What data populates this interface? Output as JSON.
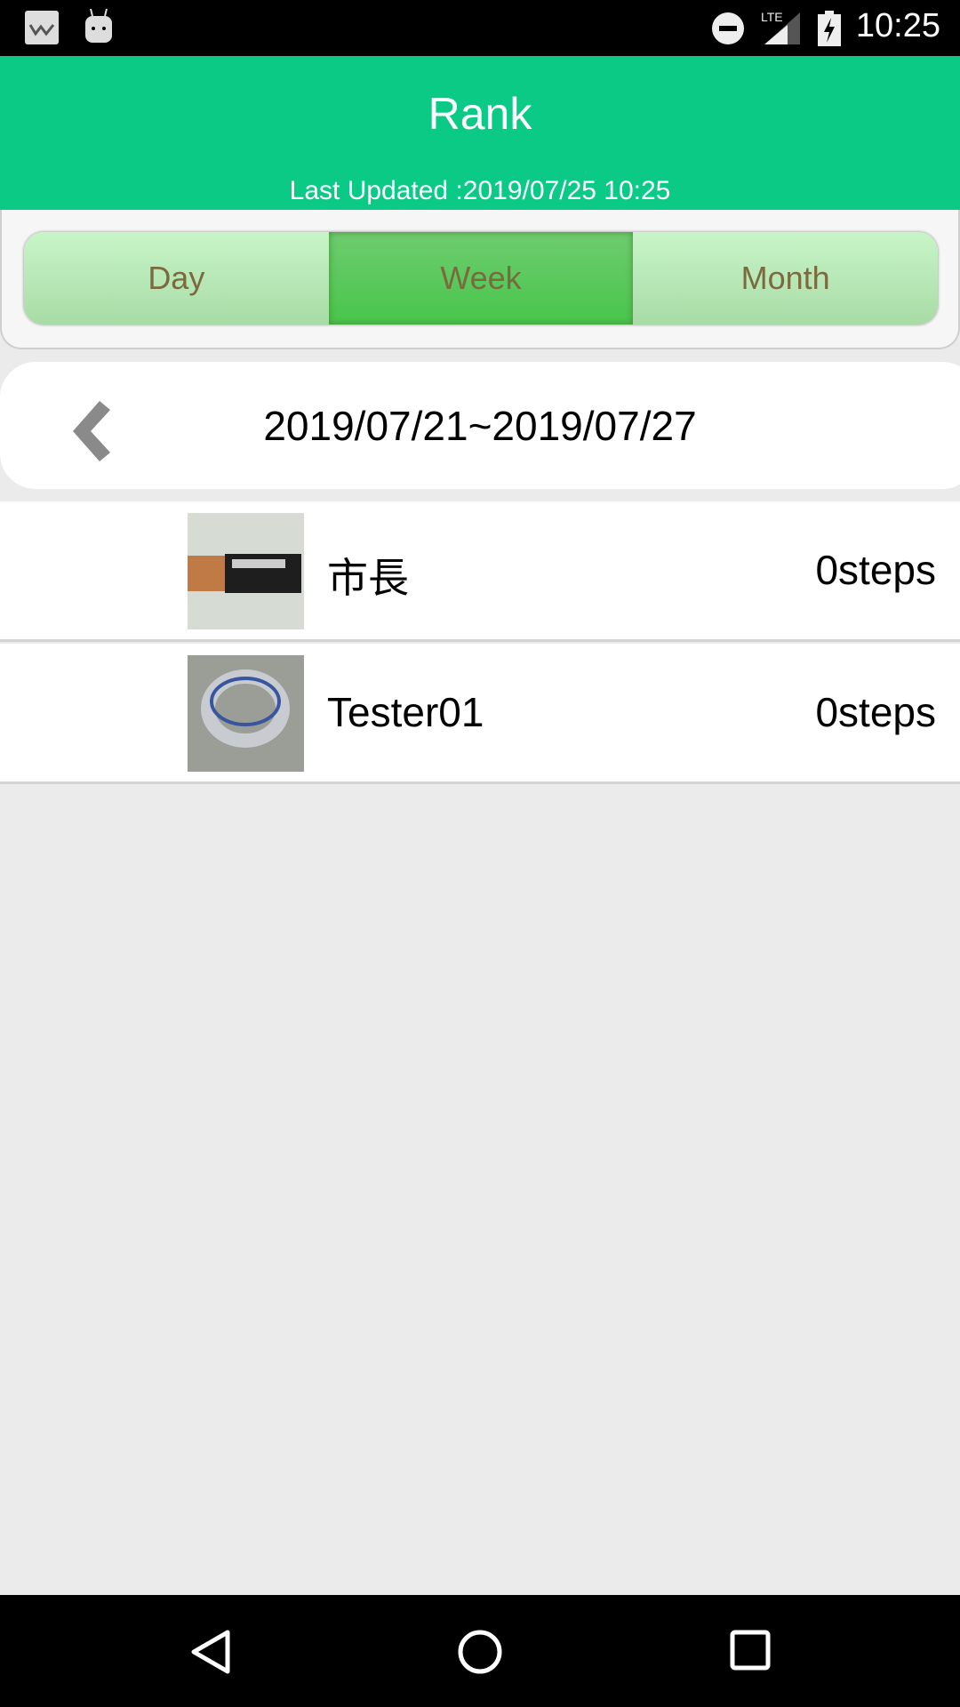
{
  "status_bar": {
    "time": "10:25",
    "icons": [
      "notification-w-icon",
      "android-icon",
      "do-not-disturb-icon",
      "lte-signal-icon",
      "battery-charging-icon"
    ]
  },
  "header": {
    "title": "Rank",
    "last_updated": "Last Updated :2019/07/25 10:25",
    "color": "#0bca86"
  },
  "segments": [
    {
      "label": "Day",
      "active": false
    },
    {
      "label": "Week",
      "active": true
    },
    {
      "label": "Month",
      "active": false
    }
  ],
  "date_range": {
    "label": "2019/07/21~2019/07/27",
    "prev_icon": "chevron-left-icon"
  },
  "rankings": [
    {
      "name": "市長",
      "steps": "0steps",
      "avatar": "battery-photo"
    },
    {
      "name": "Tester01",
      "steps": "0steps",
      "avatar": "tape-photo"
    }
  ],
  "nav_bar": {
    "icons": [
      "back-icon",
      "home-icon",
      "recents-icon"
    ]
  }
}
